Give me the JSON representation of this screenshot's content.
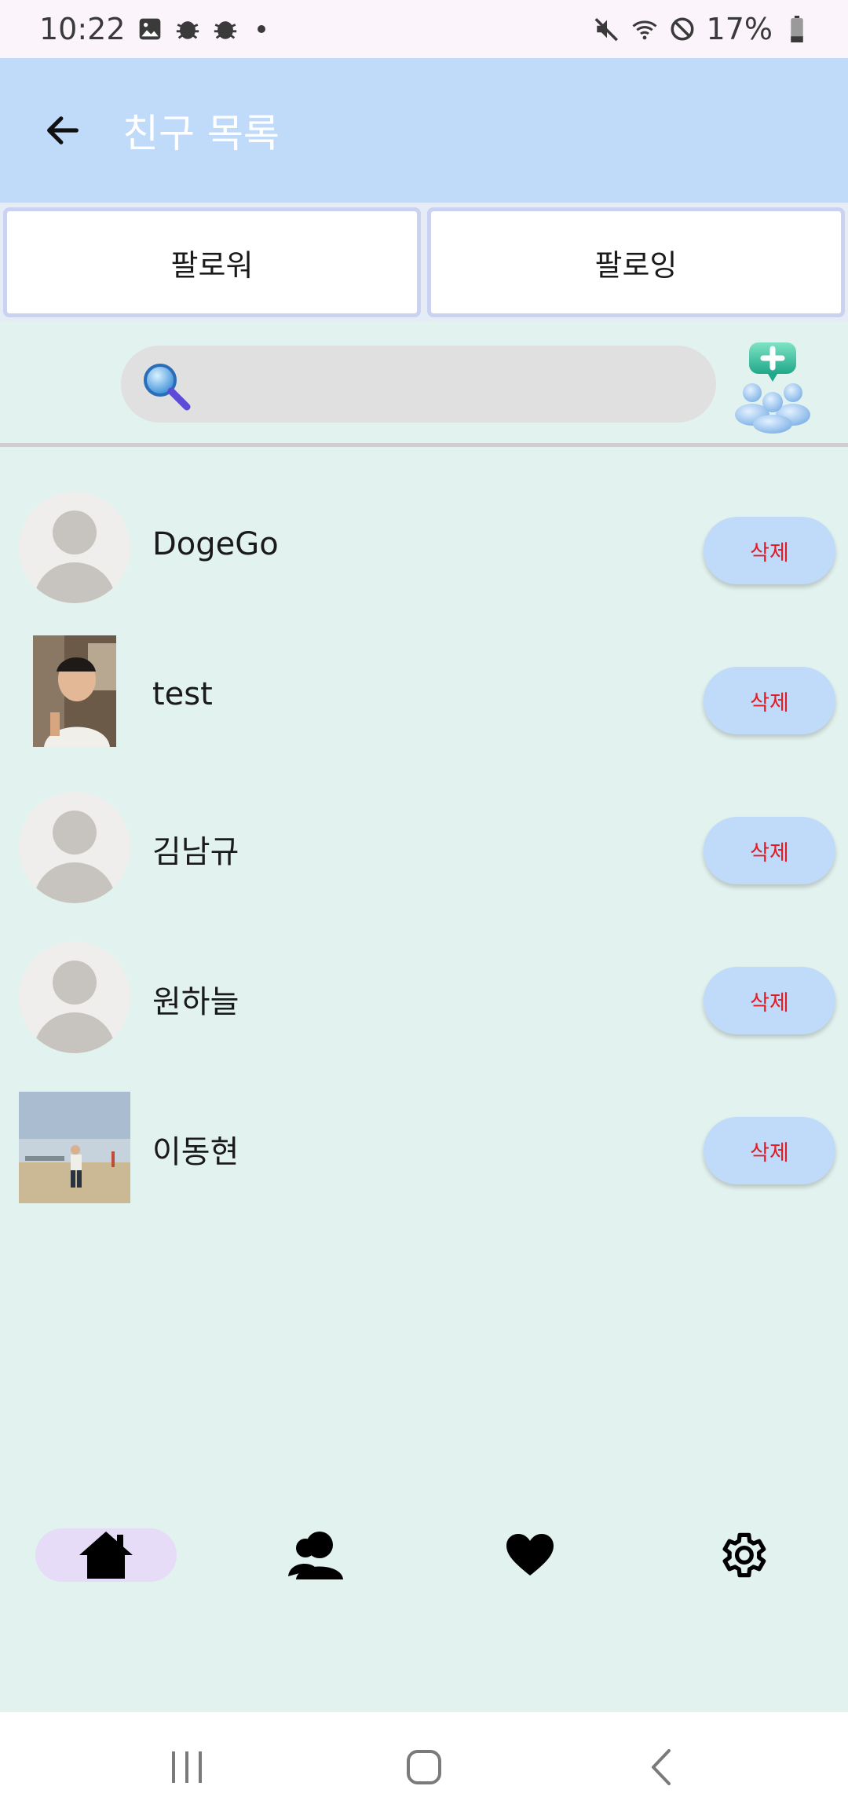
{
  "status_bar": {
    "time": "10:22",
    "battery": "17%",
    "icons": [
      "image-icon",
      "bug-icon",
      "bug-icon",
      "dot",
      "mute-icon",
      "wifi-icon",
      "dnd-icon",
      "battery-icon"
    ]
  },
  "app_bar": {
    "title": "친구 목록",
    "back_icon": "arrow-left-icon"
  },
  "tabs": [
    {
      "label": "팔로워"
    },
    {
      "label": "팔로잉"
    }
  ],
  "search": {
    "placeholder": "",
    "icon": "search-icon",
    "add_friend_icon": "add-friend-icon"
  },
  "friends": [
    {
      "name": "DogeGo",
      "avatar": "default",
      "action": "삭제"
    },
    {
      "name": "test",
      "avatar": "photo",
      "action": "삭제"
    },
    {
      "name": "김남규",
      "avatar": "default",
      "action": "삭제"
    },
    {
      "name": "원하늘",
      "avatar": "default",
      "action": "삭제"
    },
    {
      "name": "이동현",
      "avatar": "photo",
      "action": "삭제"
    }
  ],
  "bottom_nav": [
    {
      "icon": "home-icon",
      "active": true
    },
    {
      "icon": "friends-icon",
      "active": false
    },
    {
      "icon": "heart-icon",
      "active": false
    },
    {
      "icon": "settings-icon",
      "active": false
    }
  ],
  "colors": {
    "app_bar": "#c0daf9",
    "background": "#e2f2ef",
    "delete_text": "#e01b24",
    "nav_active": "#e6dcf7"
  }
}
